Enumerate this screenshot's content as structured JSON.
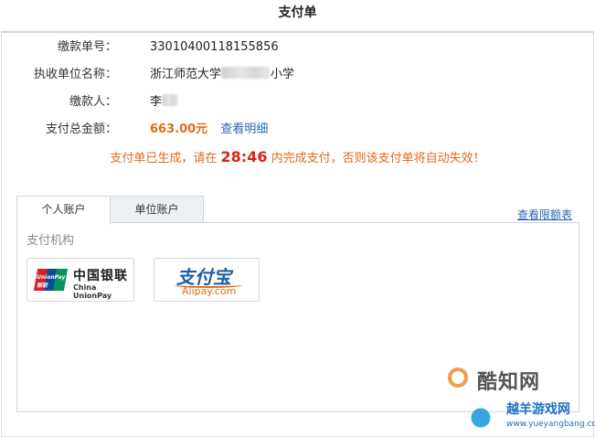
{
  "page": {
    "title": "支付单"
  },
  "details": {
    "payment_no_label": "缴款单号：",
    "payment_no": "33010400118155856",
    "unit_label": "执收单位名称：",
    "unit_prefix": "浙江师范大学",
    "unit_suffix": "小学",
    "payer_label": "缴款人：",
    "payer_prefix": "李",
    "total_label": "支付总金额：",
    "total_amount": "663.00元",
    "view_details": "查看明细"
  },
  "notice": {
    "before": "支付单已生成，请在",
    "timer": "28:46",
    "after": "内完成支付，否则该支付单将自动失效！"
  },
  "tabs": [
    {
      "label": "个人账户",
      "active": true
    },
    {
      "label": "单位账户",
      "active": false
    }
  ],
  "limit_link": "查看限额表",
  "section_label": "支付机构",
  "methods": {
    "unionpay": {
      "badge": "UnionPay 银联",
      "name_cn": "中国银联",
      "name_en": "China UnionPay"
    },
    "alipay": {
      "name_cn": "支付宝",
      "name_en": "Alipay.com"
    }
  },
  "watermarks": {
    "primary": "酷知网",
    "secondary_cn": "越羊游戏网",
    "secondary_en": "www.yueyangbang.com"
  },
  "colors": {
    "accent_orange": "#e06a1b",
    "link_blue": "#2a64b8",
    "timer_red": "#d9241a"
  }
}
